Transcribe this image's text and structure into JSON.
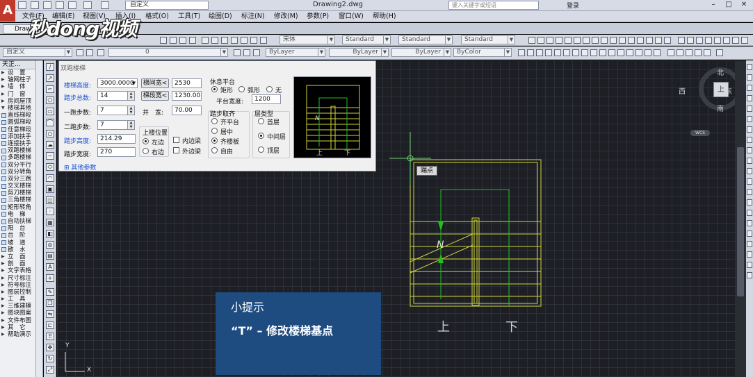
{
  "app": {
    "workspace": "自定义",
    "title": "Drawing2.dwg",
    "search_placeholder": "键入关键字或短语",
    "login": "登录"
  },
  "menu": [
    "文件(F)",
    "编辑(E)",
    "视图(V)",
    "插入(I)",
    "格式(O)",
    "工具(T)",
    "绘图(D)",
    "标注(N)",
    "修改(M)",
    "参数(P)",
    "窗口(W)",
    "帮助(H)"
  ],
  "tab": "Drawi",
  "logo": "秒dong视频",
  "toolbar1": {
    "text_style": "宋体",
    "dim_style": "Standard",
    "table_style": "Standard",
    "mleader_style": "Standard"
  },
  "toolbar2": {
    "workspace": "自定义",
    "layer": "0",
    "color": "ByLayer",
    "linetype": "ByLayer",
    "lineweight": "ByLayer",
    "plotstyle": "ByColor"
  },
  "left_panel": {
    "header": "天正...",
    "items": [
      "设　置",
      "轴网柱子",
      "墙　体",
      "门　窗",
      "房间屋顶",
      "楼梯其他",
      "直线梯段",
      "圆弧梯段",
      "任意梯段",
      "添加扶手",
      "连接扶手",
      "双跑楼梯",
      "多跑楼梯",
      "双分平行",
      "双分转角",
      "双分三跑",
      "交叉楼梯",
      "剪刀楼梯",
      "三角楼梯",
      "矩形转角",
      "电　梯",
      "自动扶梯",
      "阳　台",
      "台　阶",
      "坡　道",
      "散　水",
      "立　面",
      "剖　面",
      "文字表格",
      "尺寸标注",
      "符号标注",
      "图层控制",
      "工　具",
      "三维建模",
      "图块图案",
      "文件布图",
      "其　它",
      "帮助演示"
    ]
  },
  "dialog": {
    "title": "双跑楼梯",
    "height_label": "楼梯高度:",
    "height_value": "3000.0000",
    "steps_label": "踏步总数:",
    "steps_value": "14",
    "run1_label": "一跑步数:",
    "run1_value": "7",
    "run2_label": "二跑步数:",
    "run2_value": "7",
    "riser_label": "踏步高度:",
    "riser_value": "214.29",
    "tread_label": "踏步宽度:",
    "tread_value": "270",
    "btn_well_width": "梯间宽<",
    "well_width_value": "2530",
    "btn_run_width": "梯段宽<",
    "run_width_value": "1230.00",
    "gap_label": "井　宽:",
    "gap_value": "70.00",
    "landing_title": "休息平台",
    "landing_options": [
      "矩形",
      "弧形",
      "无"
    ],
    "landing_selected": "矩形",
    "landing_width_label": "平台宽度:",
    "landing_width_value": "1200",
    "up_pos_title": "上楼位置",
    "up_pos_options": [
      "左边",
      "右边"
    ],
    "up_pos_selected": "左边",
    "rail_options": [
      "内边梁",
      "外边梁"
    ],
    "align_title": "踏步取齐",
    "align_options": [
      "齐平台",
      "居中",
      "齐楼板",
      "自由"
    ],
    "align_selected": "齐楼板",
    "floor_title": "层类型",
    "floor_options": [
      "首层",
      "中间层",
      "顶层"
    ],
    "floor_selected": "中间层",
    "more": "其他参数",
    "preview_up": "上",
    "preview_down": "下"
  },
  "canvas": {
    "tooltip": "踹点",
    "label_up": "上",
    "label_down": "下",
    "ucs_y": "Y",
    "ucs_x": "X"
  },
  "compass": {
    "north": "北",
    "south": "南",
    "west": "西",
    "east": "东",
    "face": "上",
    "wcs": "WCS"
  },
  "tip": {
    "title": "小提示",
    "text": "“T” – 修改楼梯基点"
  }
}
